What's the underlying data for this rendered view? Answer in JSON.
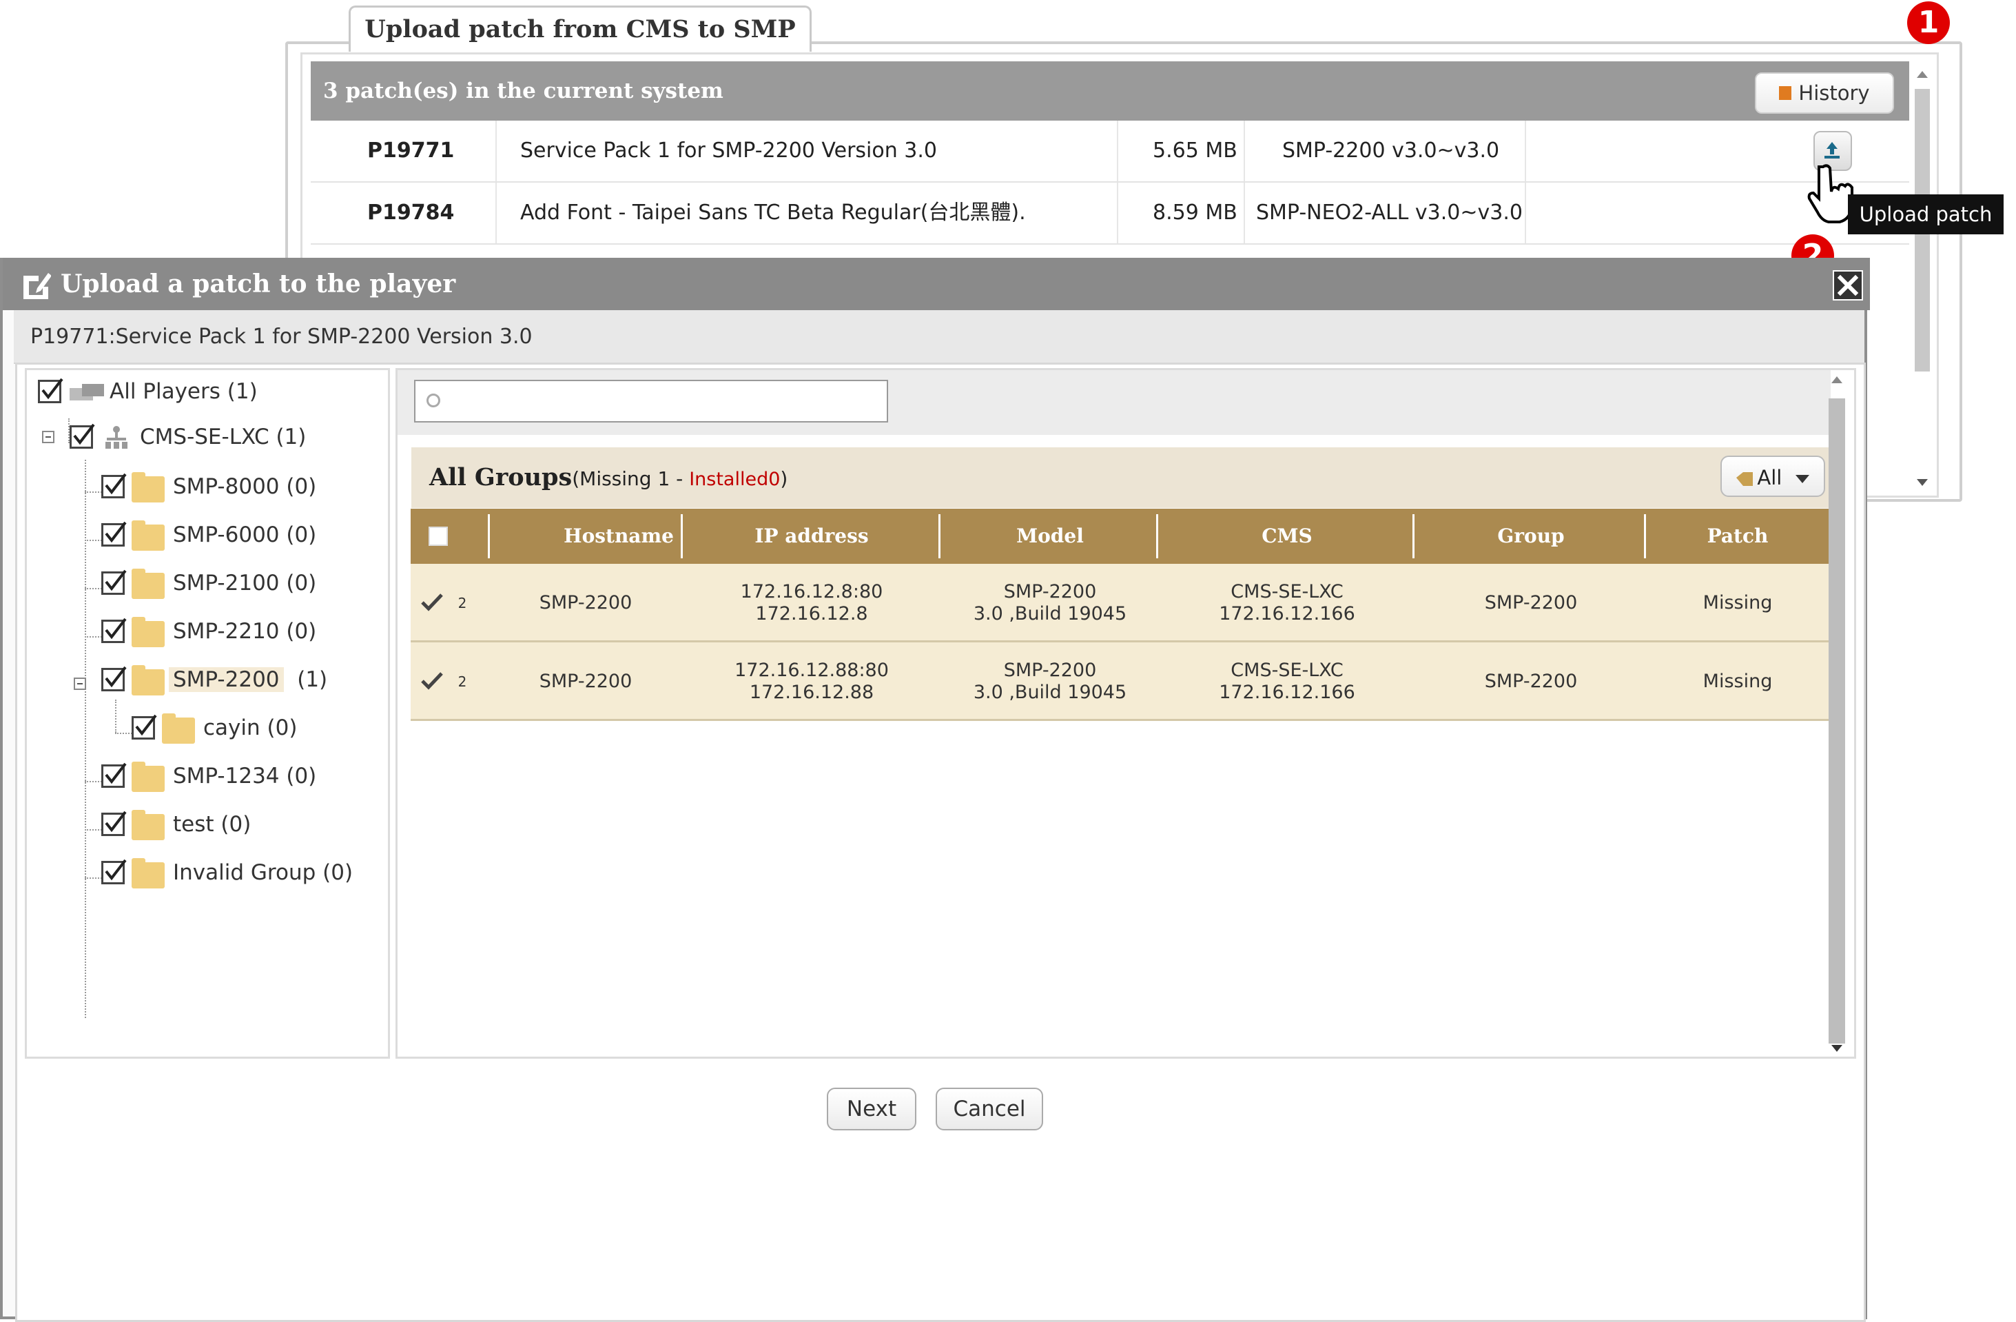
{
  "upload_window": {
    "tab_title": "Upload patch from CMS to SMP",
    "patch_count_text": "3 patch(es) in the current system",
    "history_label": "History",
    "patches": [
      {
        "id": "P19771",
        "description": "Service Pack 1 for SMP-2200 Version 3.0",
        "size": "5.65 MB",
        "compat": "SMP-2200 v3.0~v3.0"
      },
      {
        "id": "P19784",
        "description": "Add Font - Taipei Sans TC Beta Regular(台北黑體).",
        "size": "8.59 MB",
        "compat": "SMP-NEO2-ALL v3.0~v3.0"
      }
    ],
    "tooltip": "Upload patch"
  },
  "markers": {
    "one": "1",
    "two": "2"
  },
  "dialog": {
    "title": "Upload a patch to the player",
    "subtitle": "P19771:Service Pack 1 for SMP-2200 Version 3.0",
    "tree": [
      {
        "label": "All Players  (1)",
        "checked": true
      },
      {
        "label": "CMS-SE-LXC  (1)",
        "checked": true
      },
      {
        "label": "SMP-8000  (0)",
        "checked": true
      },
      {
        "label": "SMP-6000  (0)",
        "checked": true
      },
      {
        "label": "SMP-2100  (0)",
        "checked": true
      },
      {
        "label": "SMP-2210  (0)",
        "checked": true
      },
      {
        "label": "SMP-2200",
        "count": "(1)",
        "checked": true
      },
      {
        "label": "cayin  (0)",
        "checked": true
      },
      {
        "label": "SMP-1234  (0)",
        "checked": true
      },
      {
        "label": "test  (0)",
        "checked": true
      },
      {
        "label": "Invalid Group  (0)",
        "checked": true
      }
    ],
    "search_placeholder": "",
    "group_title": "All Groups",
    "group_missing": "(Missing 1 - ",
    "group_installed": "Installed0",
    "group_close": ")",
    "filter_label": "All",
    "columns": [
      "Hostname",
      "IP address",
      "Model",
      "CMS",
      "Group",
      "Patch"
    ],
    "rows": [
      {
        "num": "2",
        "hostname": "SMP-2200",
        "ip1": "172.16.12.8:80",
        "ip2": "172.16.12.8",
        "model1": "SMP-2200",
        "model2": "3.0 ,Build 19045",
        "cms1": "CMS-SE-LXC",
        "cms2": "172.16.12.166",
        "group": "SMP-2200",
        "patch": "Missing"
      },
      {
        "num": "2",
        "hostname": "SMP-2200",
        "ip1": "172.16.12.88:80",
        "ip2": "172.16.12.88",
        "model1": "SMP-2200",
        "model2": "3.0 ,Build 19045",
        "cms1": "CMS-SE-LXC",
        "cms2": "172.16.12.166",
        "group": "SMP-2200",
        "patch": "Missing"
      }
    ],
    "next_label": "Next",
    "cancel_label": "Cancel"
  },
  "colors": {
    "header_gray": "#9a9a9a",
    "table_head": "#ab8a50",
    "row_bg": "#f5ecd4",
    "installed_red": "#c00000",
    "marker_red": "#e00000"
  }
}
